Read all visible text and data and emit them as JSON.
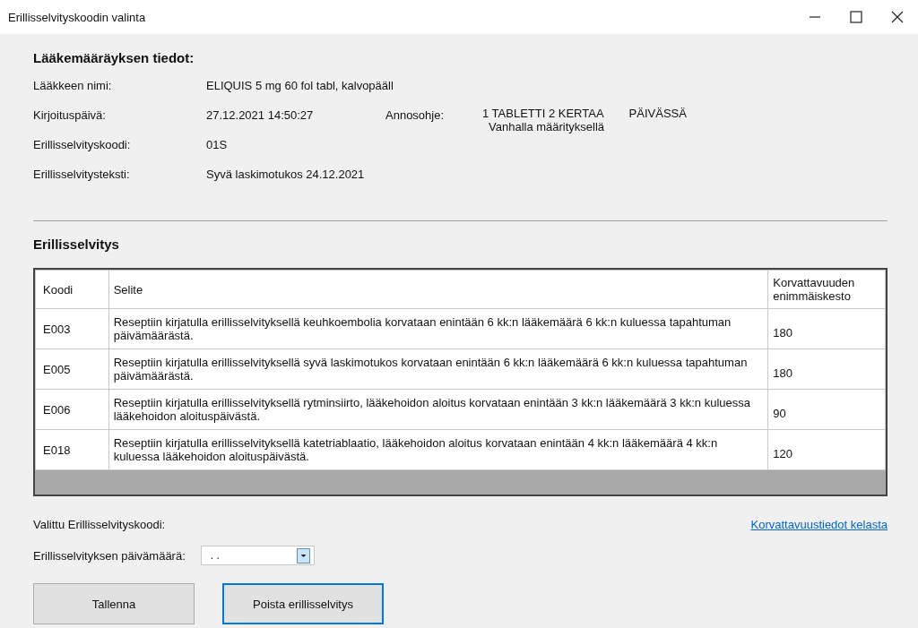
{
  "window": {
    "title": "Erillisselvityskoodin valinta"
  },
  "prescription": {
    "heading": "Lääkemääräyksen tiedot:",
    "fields": [
      {
        "label": "Lääkkeen nimi:",
        "value": "ELIQUIS 5 mg 60 fol tabl, kalvopääll"
      },
      {
        "label": "Kirjoituspäivä:",
        "value": "27.12.2021 14:50:27"
      },
      {
        "label": "Erillisselvityskoodi:",
        "value": "01S"
      },
      {
        "label": "Erillisselvitysteksti:",
        "value": "Syvä laskimotukos 24.12.2021"
      }
    ],
    "dosage": {
      "label": "Annosohje:",
      "parts": [
        "1 TABLETTI 2 KERTAA",
        "PÄIVÄSSÄ"
      ],
      "note": "Vanhalla määrityksellä"
    }
  },
  "section": {
    "heading": "Erillisselvitys"
  },
  "table": {
    "columns": [
      "Koodi",
      "Selite",
      "Korvattavuuden enimmäiskesto"
    ],
    "rows": [
      {
        "cells": [
          "E003",
          "Reseptiin kirjatulla erillisselvityksellä keuhkoembolia korvataan enintään 6 kk:n lääkemäärä 6 kk:n kuluessa tapahtuman päivämäärästä.",
          "180"
        ]
      },
      {
        "cells": [
          "E005",
          "Reseptiin kirjatulla erillisselvityksellä syvä laskimotukos korvataan enintään 6 kk:n lääkemäärä 6 kk:n kuluessa tapahtuman päivämäärästä.",
          "180"
        ]
      },
      {
        "cells": [
          "E006",
          "Reseptiin kirjatulla erillisselvityksellä rytminsiirto, lääkehoidon aloitus korvataan enintään 3 kk:n lääkemäärä 3 kk:n kuluessa lääkehoidon aloituspäivästä.",
          "90"
        ]
      },
      {
        "cells": [
          "E018",
          "Reseptiin kirjatulla erillisselvityksellä katetriablaatio, lääkehoidon aloitus korvataan enintään 4 kk:n lääkemäärä 4 kk:n kuluessa lääkehoidon aloituspäivästä.",
          "120"
        ]
      }
    ]
  },
  "selected_label": "Valittu Erillisselvityskoodi:",
  "link": "Korvattavuustiedot kelasta",
  "date": {
    "label": "Erillisselvityksen päivämäärä:",
    "value": ". ."
  },
  "buttons": [
    {
      "label": "Tallenna",
      "focused": false
    },
    {
      "label": "Poista erillisselvitys",
      "focused": true
    }
  ]
}
